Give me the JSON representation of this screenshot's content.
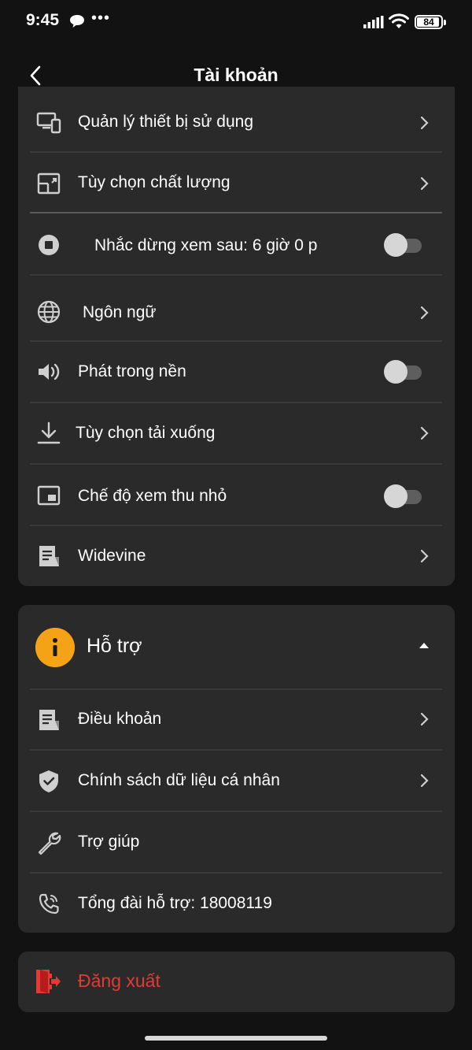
{
  "status_bar": {
    "time": "9:45",
    "dots": "•••",
    "battery": "84"
  },
  "header": {
    "title": "Tài khoản"
  },
  "settings": {
    "items": [
      {
        "label": "Quản lý thiết bị sử dụng",
        "icon": "devices-icon",
        "control": "chevron"
      },
      {
        "label": "Tùy chọn chất lượng",
        "icon": "quality-icon",
        "control": "chevron"
      },
      {
        "label": "Nhắc dừng xem sau: 6 giờ 0 p",
        "icon": "stop-circle-icon",
        "control": "toggle",
        "on": false
      },
      {
        "label": "Ngôn ngữ",
        "icon": "globe-icon",
        "control": "chevron"
      },
      {
        "label": "Phát trong nền",
        "icon": "speaker-icon",
        "control": "toggle",
        "on": false
      },
      {
        "label": "Tùy chọn tải xuống",
        "icon": "download-icon",
        "control": "chevron"
      },
      {
        "label": "Chế độ xem thu nhỏ",
        "icon": "picture-in-picture-icon",
        "control": "toggle",
        "on": false
      },
      {
        "label": "Widevine",
        "icon": "document-icon",
        "control": "chevron"
      }
    ]
  },
  "support": {
    "title": "Hỗ trợ",
    "badge_icon": "info-icon",
    "badge_color": "#f4a316",
    "items": [
      {
        "label": "Điều khoản",
        "icon": "document-icon",
        "control": "chevron"
      },
      {
        "label": "Chính sách dữ liệu cá nhân",
        "icon": "shield-icon",
        "control": "chevron"
      },
      {
        "label": "Trợ giúp",
        "icon": "wrench-icon",
        "control": "none"
      },
      {
        "label": "Tổng đài hỗ trợ: 18008119",
        "icon": "phone-icon",
        "control": "none"
      }
    ]
  },
  "logout": {
    "label": "Đăng xuất",
    "color": "#e53935"
  }
}
